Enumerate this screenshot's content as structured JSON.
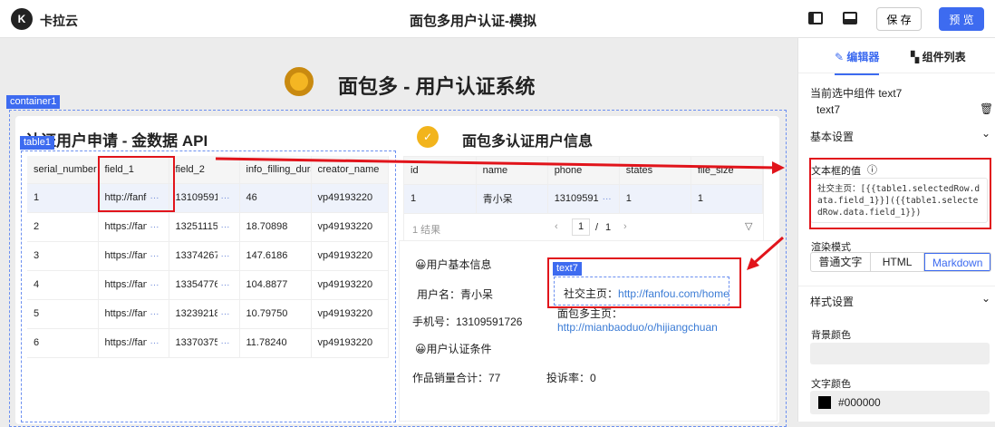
{
  "header": {
    "brand": "卡拉云",
    "title": "面包多用户认证-模拟",
    "save": "保 存",
    "preview": "预 览"
  },
  "canvas": {
    "page_title": "面包多 - 用户认证系统",
    "container_tag": "container1",
    "table_tag": "table1",
    "text_tag": "text7",
    "left_title": "认证用户申请 - 金数据 API",
    "right_title": "面包多认证用户信息",
    "table1": {
      "columns": [
        "serial_number",
        "field_1",
        "field_2",
        "info_filling_dura",
        "creator_name"
      ],
      "rows": [
        [
          "1",
          "http://fanfo",
          "13109591",
          "46",
          "vp49193220"
        ],
        [
          "2",
          "https://fan",
          "13251115",
          "18.70898",
          "vp49193220"
        ],
        [
          "3",
          "https://fan",
          "13374267",
          "147.6186",
          "vp49193220"
        ],
        [
          "4",
          "https://fan",
          "13354776",
          "104.8877",
          "vp49193220"
        ],
        [
          "5",
          "https://fan",
          "13239218",
          "10.79750",
          "vp49193220"
        ],
        [
          "6",
          "https://fan",
          "13370375",
          "11.78240",
          "vp49193220"
        ]
      ]
    },
    "table2": {
      "columns": [
        "id",
        "name",
        "phone",
        "states",
        "file_size"
      ],
      "rows": [
        [
          "1",
          "青小呆",
          "13109591",
          "1",
          "1"
        ]
      ],
      "result_count": "1 结果",
      "page": "1",
      "page_sep": "/",
      "total_pages": "1"
    },
    "info": {
      "basic_heading": "😀用户基本信息",
      "username": "用户名：青小呆",
      "phone": "手机号：13109591726",
      "social_label": "社交主页：",
      "social_link": "http://fanfou.com/home",
      "home_label": "面包多主页：",
      "home_link": "http://mianbaoduo/o/hijiangchuan",
      "cond_heading": "😀用户认证条件",
      "sales": "作品销量合计：77",
      "complaint": "投诉率：0"
    }
  },
  "panel": {
    "tabs": [
      "编辑器",
      "组件列表"
    ],
    "selected_label": "当前选中组件 text7",
    "component_name": "text7",
    "basic_settings": "基本设置",
    "value_label": "文本框的值",
    "value": "社交主页：[{{table1.selectedRow.data.field_1}}]({{table1.selectedRow.data.field_1}})",
    "render_label": "渲染模式",
    "render_modes": [
      "普通文字",
      "HTML",
      "Markdown"
    ],
    "style_settings": "样式设置",
    "bg_label": "背景颜色",
    "text_color_label": "文字颜色",
    "text_color": "#000000"
  }
}
